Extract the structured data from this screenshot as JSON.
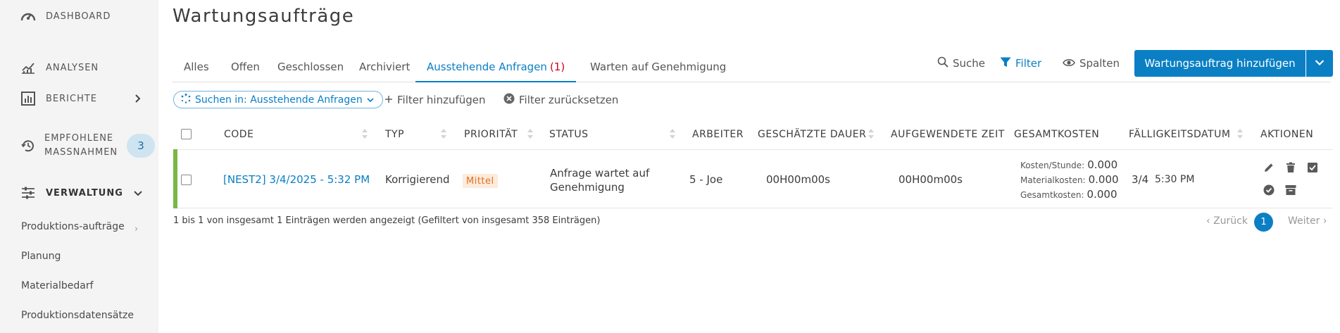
{
  "sidebar": {
    "items": [
      {
        "label": "DASHBOARD",
        "icon": "gauge-icon"
      },
      {
        "label": "ANALYSEN",
        "icon": "chart-line-icon"
      },
      {
        "label": "BERICHTE",
        "icon": "report-icon"
      },
      {
        "label_line1": "EMPFOHLENE",
        "label_line2": "MASSNAHMEN",
        "badge": "3",
        "icon": "history-icon"
      },
      {
        "label": "VERWALTUNG",
        "icon": "sliders-icon"
      }
    ],
    "sub_items": [
      {
        "label": "Produktions-aufträge",
        "chevron": "›"
      },
      {
        "label": "Planung"
      },
      {
        "label": "Materialbedarf"
      },
      {
        "label": "Produktionsdatensätze"
      }
    ]
  },
  "page": {
    "title": "Wartungsaufträge"
  },
  "tabs": [
    {
      "label": "Alles"
    },
    {
      "label": "Offen"
    },
    {
      "label": "Geschlossen"
    },
    {
      "label": "Archiviert"
    },
    {
      "label": "Ausstehende Anfragen",
      "count": "(1)",
      "active": true
    },
    {
      "label": "Warten auf Genehmigung"
    }
  ],
  "toolbar": {
    "search_label": "Suche",
    "filter_label": "Filter",
    "columns_label": "Spalten",
    "add_button_label": "Wartungsauftrag hinzufügen"
  },
  "filters": {
    "chip_label": "Suchen in: Ausstehende Anfragen",
    "add_filter_label": "Filter hinzufügen",
    "reset_filter_label": "Filter zurücksetzen"
  },
  "table": {
    "headers": {
      "code": "CODE",
      "type": "TYP",
      "priority": "PRIORITÄT",
      "status": "STATUS",
      "worker": "ARBEITER",
      "est_duration": "GESCHÄTZTE DAUER",
      "spent_time": "AUFGEWENDETE ZEIT",
      "total_cost": "GESAMTKOSTEN",
      "due_date": "FÄLLIGKEITSDATUM",
      "actions": "AKTIONEN"
    },
    "rows": [
      {
        "code": "[NEST2] 3/4/2025 - 5:32 PM",
        "type": "Korrigierend",
        "priority": "Mittel",
        "status_line1": "Anfrage wartet auf",
        "status_line2": "Genehmigung",
        "worker": "5 - Joe",
        "est_duration": "00H00m00s",
        "spent_time": "00H00m00s",
        "cost_per_hour_label": "Kosten/Stunde:",
        "cost_per_hour": "0.000",
        "material_cost_label": "Materialkosten:",
        "material_cost": "0.000",
        "total_cost_label": "Gesamtkosten:",
        "total_cost": "0.000",
        "due_day": "3/4",
        "due_time": "5:30 PM"
      }
    ]
  },
  "footer": {
    "info": "1 bis 1 von insgesamt 1 Einträgen werden angezeigt (Gefiltert von insgesamt 358 Einträgen)",
    "prev_label": "Zurück",
    "current_page": "1",
    "next_label": "Weiter"
  },
  "colors": {
    "accent": "#0a7fc4",
    "row_indicator": "#7ab648",
    "priority_bg": "#fdebdc",
    "priority_text": "#e07024",
    "count_red": "#d0021b"
  }
}
